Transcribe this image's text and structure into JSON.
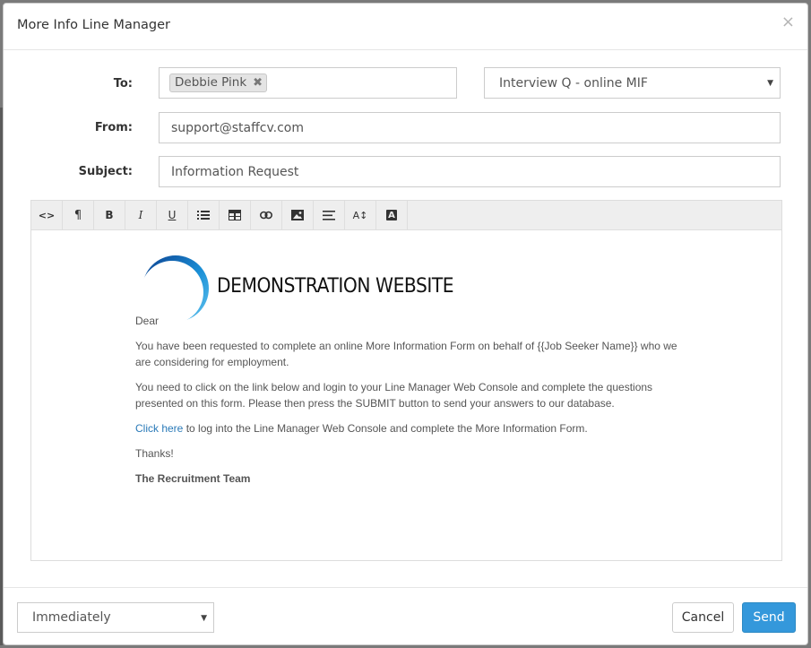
{
  "modal": {
    "title": "More Info Line Manager",
    "close_symbol": "×"
  },
  "form": {
    "to_label": "To:",
    "to_tags": [
      "Debbie Pink"
    ],
    "tag_remove_symbol": "✖",
    "template_select": "Interview Q - online MIF",
    "from_label": "From:",
    "from_value": "support@staffcv.com",
    "subject_label": "Subject:",
    "subject_value": "Information Request"
  },
  "toolbar": {
    "buttons": [
      {
        "name": "code-view",
        "icon": "code-icon",
        "glyph": "<>"
      },
      {
        "name": "paragraph",
        "icon": "paragraph-icon",
        "glyph": "¶"
      },
      {
        "name": "bold",
        "icon": "bold-icon",
        "glyph": "B"
      },
      {
        "name": "italic",
        "icon": "italic-icon",
        "glyph": "I"
      },
      {
        "name": "underline",
        "icon": "underline-icon",
        "glyph": "U"
      },
      {
        "name": "list",
        "icon": "list-icon",
        "glyph": ""
      },
      {
        "name": "table",
        "icon": "table-icon",
        "glyph": ""
      },
      {
        "name": "link",
        "icon": "link-icon",
        "glyph": ""
      },
      {
        "name": "image",
        "icon": "image-icon",
        "glyph": ""
      },
      {
        "name": "align",
        "icon": "align-icon",
        "glyph": ""
      },
      {
        "name": "font-size",
        "icon": "font-size-icon",
        "glyph": "A↕"
      },
      {
        "name": "font-color",
        "icon": "font-color-icon",
        "glyph": "A"
      }
    ]
  },
  "email": {
    "logo_text": "DEMONSTRATION WEBSITE",
    "greeting": "Dear",
    "para1": "You have been requested to complete an online More Information Form on behalf of {{Job Seeker Name}} who we are considering for employment.",
    "para2": "You need to click on the link below and login to your Line Manager Web Console and complete the questions presented on this form. Please then press the SUBMIT button to send your answers to our database.",
    "link_text": "Click here",
    "para3_rest": " to log into the Line Manager Web Console and complete the More Information Form.",
    "thanks": "Thanks!",
    "signature": "The Recruitment Team"
  },
  "footer": {
    "schedule_select": "Immediately",
    "cancel_label": "Cancel",
    "send_label": "Send"
  },
  "colors": {
    "primary": "#3498db",
    "link": "#2a7ab8",
    "logo_ring": "#1a8fd6",
    "backdrop": "#7a7a7a"
  }
}
